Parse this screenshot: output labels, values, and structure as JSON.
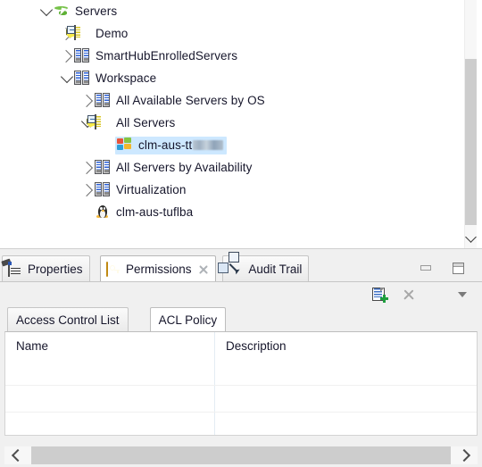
{
  "tree": {
    "name": "servers-tree",
    "scroll": {
      "vertical_thumb": "partial",
      "down_arrow_icon": "chevron-down-icon"
    },
    "rows": [
      {
        "label": "Servers",
        "icon": "globe-cursor-icon",
        "indent": 0,
        "expander": "down",
        "selected": false,
        "redacted": false
      },
      {
        "label": "Demo",
        "icon": "server-group-icon",
        "indent": 1,
        "expander": "right",
        "selected": false,
        "redacted": false
      },
      {
        "label": "SmartHubEnrolledServers",
        "icon": "server-rack-icon",
        "indent": 1,
        "expander": "right",
        "selected": false,
        "redacted": false
      },
      {
        "label": "Workspace",
        "icon": "server-rack-icon",
        "indent": 1,
        "expander": "down",
        "selected": false,
        "redacted": false
      },
      {
        "label": "All Available Servers by OS",
        "icon": "server-rack-icon",
        "indent": 2,
        "expander": "right",
        "selected": false,
        "redacted": false
      },
      {
        "label": "All Servers",
        "icon": "server-group-icon",
        "indent": 2,
        "expander": "down",
        "selected": false,
        "redacted": false
      },
      {
        "label": "clm-aus-tt",
        "icon": "windows-icon",
        "indent": 3,
        "expander": "none",
        "selected": true,
        "redacted": true
      },
      {
        "label": "All Servers by Availability",
        "icon": "server-rack-icon",
        "indent": 2,
        "expander": "right",
        "selected": false,
        "redacted": false
      },
      {
        "label": "Virtualization",
        "icon": "server-rack-icon",
        "indent": 2,
        "expander": "right",
        "selected": false,
        "redacted": false
      },
      {
        "label": "clm-aus-tuflba",
        "icon": "linux-penguin-icon",
        "indent": 2,
        "expander": "none",
        "selected": false,
        "redacted": false
      }
    ]
  },
  "view_stack": {
    "tabs": [
      {
        "label": "Properties",
        "icon": "properties-icon",
        "active": false,
        "closable": false
      },
      {
        "label": "Permissions",
        "icon": "key-icon",
        "active": true,
        "closable": true
      },
      {
        "label": "Audit Trail",
        "icon": "audit-trail-icon",
        "active": false,
        "closable": false
      }
    ],
    "window_buttons": [
      {
        "name": "minimize-button",
        "icon": "minimize-icon"
      },
      {
        "name": "maximize-button",
        "icon": "maximize-icon"
      }
    ],
    "toolbar": [
      {
        "name": "add-acl-policy-button",
        "icon": "add-policy-icon",
        "enabled": true
      },
      {
        "name": "delete-button",
        "icon": "delete-x-icon",
        "enabled": false
      },
      {
        "name": "view-menu-button",
        "icon": "view-menu-icon",
        "enabled": true
      }
    ],
    "inner_tabs": [
      {
        "label": "Access Control List",
        "active": false
      },
      {
        "label": "ACL Policy",
        "active": true
      }
    ],
    "table": {
      "columns": [
        "Name",
        "Description"
      ],
      "rows": [],
      "empty_row_count": 3
    },
    "hscroll": {
      "left_icon": "chevron-left-icon",
      "right_icon": "chevron-right-icon"
    }
  },
  "colors": {
    "selection": "#cde8ff",
    "panel_bg": "#f0f0f0",
    "tab_active_bg": "#ffffff",
    "border": "#c6c6c6",
    "text": "#16162b",
    "scroll_thumb": "#cdcdcd",
    "key_accent": "#e8a317",
    "plus_green": "#1e9e3e"
  }
}
